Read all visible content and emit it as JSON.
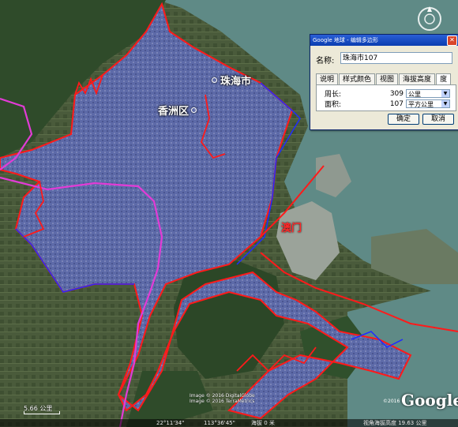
{
  "map": {
    "labels": {
      "zhuhai": "珠海市",
      "xiangzhou": "香洲区",
      "macau": "澳门"
    }
  },
  "dialog": {
    "title": "Google 地球 - 编辑多边形",
    "close_glyph": "✕",
    "name_label": "名称:",
    "name_value": "珠海市107",
    "tabs": [
      "说明",
      "样式颜色",
      "视图",
      "海拔高度",
      "度"
    ],
    "active_tab": "度",
    "perimeter_label": "周长:",
    "perimeter_value": "309",
    "perimeter_unit": "公里",
    "area_label": "面积:",
    "area_value": "107",
    "area_unit": "平方公里",
    "ok_label": "确定",
    "cancel_label": "取消"
  },
  "footer": {
    "scale_text": "5.66 公里",
    "credit_line1": "Image © 2016 DigitalGlobe",
    "credit_line2": "Image © 2016 TerraMetrics",
    "google_logo": "Google",
    "google_year": "©2016"
  },
  "status": {
    "lat": "22°11'34\"",
    "lon": "113°36'45\"",
    "elev": "海拔 0 米",
    "eye": "视角海拔高度 19.63 公里"
  },
  "colors": {
    "urban_fill": "#5d6aa8",
    "boundary_red": "#ff1a1a",
    "boundary_blue": "#1f2bff",
    "boundary_magenta": "#e23bd6",
    "water": "#5f8a86",
    "vegetation": "#2f4b2a"
  }
}
